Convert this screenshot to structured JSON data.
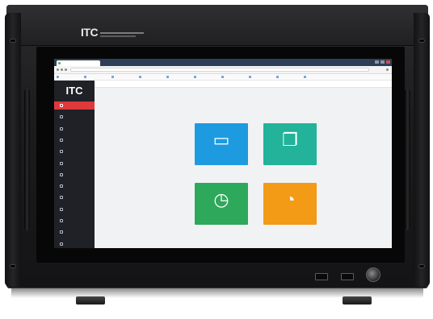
{
  "device": {
    "brand": "ITC",
    "brand_caption": ""
  },
  "browser": {
    "tab_title": "",
    "url": "",
    "bookmarks": [
      "",
      "",
      "",
      "",
      "",
      "",
      "",
      "",
      "",
      ""
    ]
  },
  "app": {
    "logo": "ITC",
    "user_label": "",
    "breadcrumb": "",
    "menu": [
      {
        "label": "",
        "active": true
      },
      {
        "label": "",
        "active": false
      },
      {
        "label": "",
        "active": false
      },
      {
        "label": "",
        "active": false
      },
      {
        "label": "",
        "active": false
      },
      {
        "label": "",
        "active": false
      },
      {
        "label": "",
        "active": false
      },
      {
        "label": "",
        "active": false
      },
      {
        "label": "",
        "active": false
      },
      {
        "label": "",
        "active": false
      },
      {
        "label": "",
        "active": false
      },
      {
        "label": "",
        "active": false
      },
      {
        "label": "",
        "active": false
      }
    ],
    "tiles": [
      {
        "name": "monitor-tile",
        "icon": "desktop-icon",
        "glyph": "▭",
        "label": "",
        "color": "#1e9be0"
      },
      {
        "name": "device-tile",
        "icon": "copy-icon",
        "glyph": "❐",
        "label": "",
        "color": "#22b39a"
      },
      {
        "name": "timer-tile",
        "icon": "stopwatch-icon",
        "glyph": "◷",
        "label": "",
        "color": "#2ea85a"
      },
      {
        "name": "schedule-tile",
        "icon": "clock-arrow-icon",
        "glyph": "◔",
        "label": "",
        "color": "#f39a16"
      }
    ]
  },
  "colors": {
    "sidebar": "#1f2127",
    "active_menu": "#e0393b",
    "chassis": "#1c1c1e"
  }
}
